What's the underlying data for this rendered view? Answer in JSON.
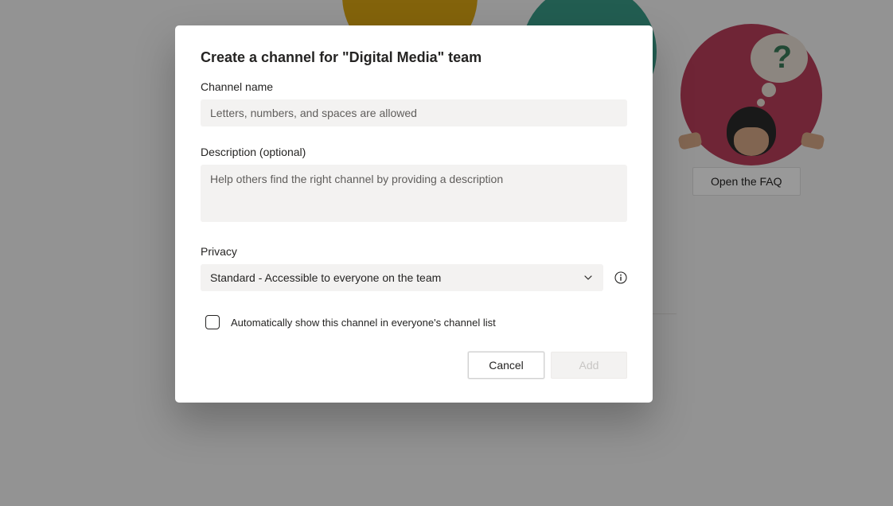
{
  "background": {
    "faq_button": "Open the FAQ"
  },
  "dialog": {
    "title": "Create a channel for \"Digital Media\" team",
    "channel_name": {
      "label": "Channel name",
      "placeholder": "Letters, numbers, and spaces are allowed",
      "value": ""
    },
    "description": {
      "label": "Description (optional)",
      "placeholder": "Help others find the right channel by providing a description",
      "value": ""
    },
    "privacy": {
      "label": "Privacy",
      "selected": "Standard - Accessible to everyone on the team"
    },
    "auto_show": {
      "label": "Automatically show this channel in everyone's channel list",
      "checked": false
    },
    "actions": {
      "cancel": "Cancel",
      "add": "Add"
    }
  }
}
